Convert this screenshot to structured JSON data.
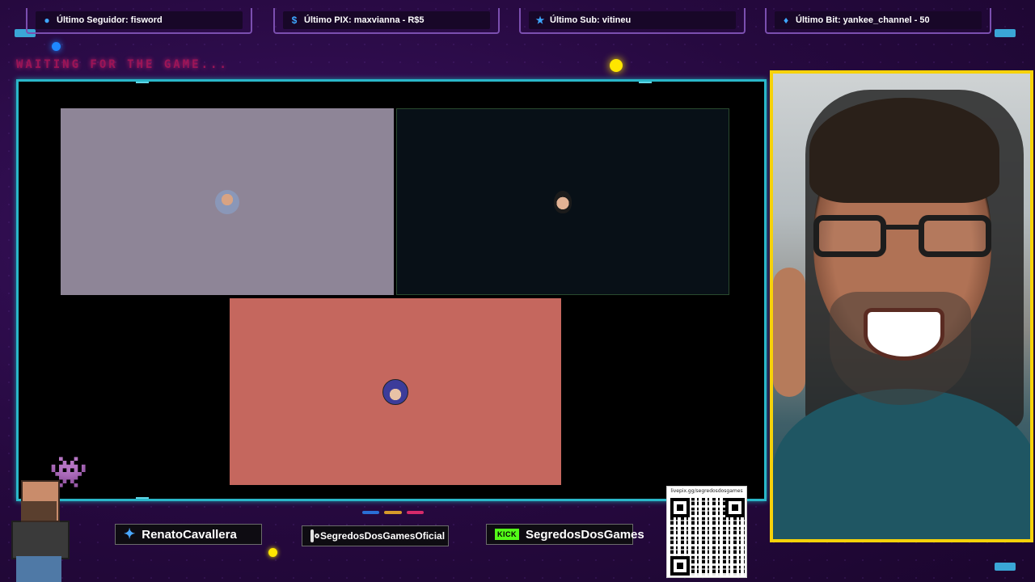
{
  "topbar": {
    "follower": {
      "label": "Último Seguidor: fisword",
      "icon": "user-icon"
    },
    "pix": {
      "label": "Último PIX: maxvianna - R$5",
      "icon": "dollar-icon"
    },
    "sub": {
      "label": "Último Sub: vitineu",
      "icon": "star-icon"
    },
    "bit": {
      "label": "Último Bit: yankee_channel - 50",
      "icon": "diamond-icon"
    }
  },
  "status_text": "WAITING FOR THE GAME...",
  "socials": {
    "twitter": {
      "handle": "RenatoCavallera",
      "icon": "twitter-icon"
    },
    "instagram": {
      "handle": "SegredosDosGamesOficial",
      "icon": "instagram-icon"
    },
    "kick": {
      "badge": "KICK",
      "handle": "SegredosDosGames",
      "icon": "kick-icon"
    }
  },
  "qr": {
    "url": "livepix.gg/segredosdosgames"
  },
  "colors": {
    "accent_cyan": "#2ab7c9",
    "cam_border": "#f6d20a",
    "tile_grey": "#8e8597",
    "tile_dark": "#081017",
    "tile_red": "#c5675e",
    "neon_pink": "#ff1f8f"
  }
}
